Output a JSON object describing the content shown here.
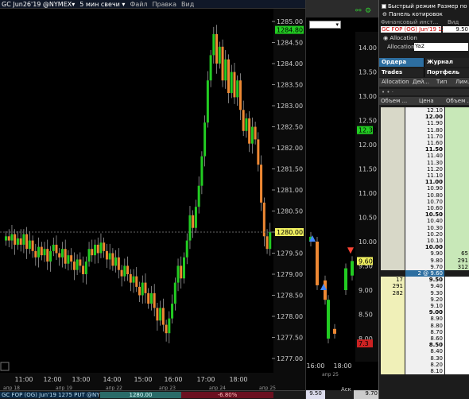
{
  "left_window": {
    "symbol": "GC Jun26'19 @NYMEX▾",
    "interval": "5 мин свечи ▾",
    "menu": [
      "Файл",
      "Правка",
      "Вид"
    ]
  },
  "left_axis": {
    "price_ticks": [
      "1285.00",
      "1284.50",
      "1284.00",
      "1283.50",
      "1283.00",
      "1282.50",
      "1282.00",
      "1281.50",
      "1281.00",
      "1280.50",
      "1280.00",
      "1279.50",
      "1279.00",
      "1278.50",
      "1278.00",
      "1277.50",
      "1277.00"
    ],
    "time_ticks": [
      "11:00",
      "12:00",
      "13:00",
      "14:00",
      "15:00",
      "16:00",
      "17:00",
      "18:00"
    ],
    "date_ticks": [
      "апр 18",
      "апр 19",
      "апр 22",
      "апр 23",
      "апр 24",
      "апр 25"
    ],
    "top_price_box": "1284.80",
    "current_price_box": "1280.00"
  },
  "left_bottom": {
    "instrument": "GC FOP (OG) Jun'19 1275 PUT @NYMEX",
    "last": "1280.00",
    "change": "-6.80%"
  },
  "mid_window": {
    "price_ticks": [
      "14.00",
      "13.50",
      "13.00",
      "12.50",
      "12.00",
      "11.50",
      "11.00",
      "10.50",
      "10.00",
      "9.50",
      "9.00",
      "8.50",
      "8.00"
    ],
    "time_ticks": [
      "16:00",
      "18:00"
    ],
    "date_tick": "апр 25",
    "green_box": "12.30",
    "yellow_box": "9.60",
    "red_box": "7.3",
    "bottom_value": "9.50",
    "ask_label": "Аск",
    "ask_value": "9.70"
  },
  "right_panel": {
    "fast_mode": "Быстрый режим",
    "size_label": "Размер по",
    "quote_panel": "Панель котировок",
    "fin_instr": "Финансовый инст...",
    "view_label": "Вид",
    "instr_value": "GC FOP (OG) Jun'19 12",
    "price_value": "9.50",
    "allocation_section": "Allocation",
    "allocation_label": "Allocation",
    "allocation_value": "Ya2",
    "tabs1": [
      "Ордера",
      "Журнал"
    ],
    "tabs2": [
      "Trades",
      "Портфель"
    ],
    "cols1": [
      "Allocation",
      "Дей...",
      "Тип",
      "Лим."
    ],
    "cols2": [
      "Объем ...",
      "Цена",
      "Объем ..."
    ]
  },
  "ladder": [
    {
      "price": "12.10",
      "bid": "",
      "ask": "",
      "zone": "upper",
      "bold": false
    },
    {
      "price": "12.00",
      "bid": "",
      "ask": "",
      "zone": "upper",
      "bold": true
    },
    {
      "price": "11.90",
      "bid": "",
      "ask": "",
      "zone": "upper",
      "bold": false
    },
    {
      "price": "11.80",
      "bid": "",
      "ask": "",
      "zone": "upper",
      "bold": false
    },
    {
      "price": "11.70",
      "bid": "",
      "ask": "",
      "zone": "upper",
      "bold": false
    },
    {
      "price": "11.60",
      "bid": "",
      "ask": "",
      "zone": "upper",
      "bold": false
    },
    {
      "price": "11.50",
      "bid": "",
      "ask": "",
      "zone": "upper",
      "bold": true
    },
    {
      "price": "11.40",
      "bid": "",
      "ask": "",
      "zone": "upper",
      "bold": false
    },
    {
      "price": "11.30",
      "bid": "",
      "ask": "",
      "zone": "upper",
      "bold": false
    },
    {
      "price": "11.20",
      "bid": "",
      "ask": "",
      "zone": "upper",
      "bold": false
    },
    {
      "price": "11.10",
      "bid": "",
      "ask": "",
      "zone": "upper",
      "bold": false
    },
    {
      "price": "11.00",
      "bid": "",
      "ask": "",
      "zone": "upper",
      "bold": true
    },
    {
      "price": "10.90",
      "bid": "",
      "ask": "",
      "zone": "upper",
      "bold": false
    },
    {
      "price": "10.80",
      "bid": "",
      "ask": "",
      "zone": "upper",
      "bold": false
    },
    {
      "price": "10.70",
      "bid": "",
      "ask": "",
      "zone": "upper",
      "bold": false
    },
    {
      "price": "10.60",
      "bid": "",
      "ask": "",
      "zone": "upper",
      "bold": false
    },
    {
      "price": "10.50",
      "bid": "",
      "ask": "",
      "zone": "upper",
      "bold": true
    },
    {
      "price": "10.40",
      "bid": "",
      "ask": "",
      "zone": "upper",
      "bold": false
    },
    {
      "price": "10.30",
      "bid": "",
      "ask": "",
      "zone": "upper",
      "bold": false
    },
    {
      "price": "10.20",
      "bid": "",
      "ask": "",
      "zone": "upper",
      "bold": false
    },
    {
      "price": "10.10",
      "bid": "",
      "ask": "",
      "zone": "upper",
      "bold": false
    },
    {
      "price": "10.00",
      "bid": "",
      "ask": "",
      "zone": "upper",
      "bold": true
    },
    {
      "price": "9.90",
      "bid": "",
      "ask": "65",
      "zone": "upper",
      "bold": false
    },
    {
      "price": "9.80",
      "bid": "",
      "ask": "291",
      "zone": "upper",
      "bold": false
    },
    {
      "price": "9.70",
      "bid": "",
      "ask": "312",
      "zone": "upper",
      "bold": false
    },
    {
      "price": "2 @ 9.60",
      "bid": "",
      "ask": "",
      "zone": "last",
      "bold": false
    },
    {
      "price": "9.50",
      "bid": "17",
      "ask": "",
      "zone": "lower",
      "bold": true
    },
    {
      "price": "9.40",
      "bid": "291",
      "ask": "",
      "zone": "lower",
      "bold": false
    },
    {
      "price": "9.30",
      "bid": "282",
      "ask": "",
      "zone": "lower",
      "bold": false
    },
    {
      "price": "9.20",
      "bid": "",
      "ask": "",
      "zone": "lower",
      "bold": false
    },
    {
      "price": "9.10",
      "bid": "",
      "ask": "",
      "zone": "lower",
      "bold": false
    },
    {
      "price": "9.00",
      "bid": "",
      "ask": "",
      "zone": "lower",
      "bold": true
    },
    {
      "price": "8.90",
      "bid": "",
      "ask": "",
      "zone": "lower",
      "bold": false
    },
    {
      "price": "8.80",
      "bid": "",
      "ask": "",
      "zone": "lower",
      "bold": false
    },
    {
      "price": "8.70",
      "bid": "",
      "ask": "",
      "zone": "lower",
      "bold": false
    },
    {
      "price": "8.60",
      "bid": "",
      "ask": "",
      "zone": "lower",
      "bold": false
    },
    {
      "price": "8.50",
      "bid": "",
      "ask": "",
      "zone": "lower",
      "bold": true
    },
    {
      "price": "8.40",
      "bid": "",
      "ask": "",
      "zone": "lower",
      "bold": false
    },
    {
      "price": "8.30",
      "bid": "",
      "ask": "",
      "zone": "lower",
      "bold": false
    },
    {
      "price": "8.20",
      "bid": "",
      "ask": "",
      "zone": "lower",
      "bold": false
    },
    {
      "price": "8.10",
      "bid": "",
      "ask": "",
      "zone": "lower",
      "bold": false
    }
  ],
  "colors": {
    "up": "#22cc22",
    "down": "#ee8833",
    "bg": "#000000",
    "last_row": "#2d6ea0"
  }
}
